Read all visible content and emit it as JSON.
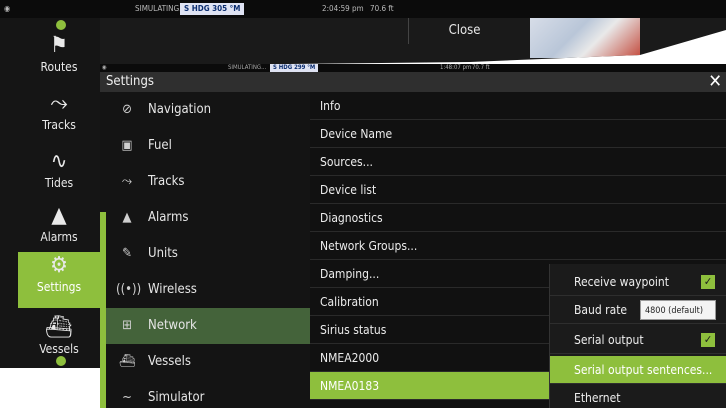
{
  "back": {
    "status": {
      "sim": "SIMULATING...",
      "hdg": "S HDG 305 °M",
      "time": "2:04:59 pm",
      "depth": "70.6 ft"
    },
    "close_label": "Close",
    "sidebar": [
      {
        "label": "Routes",
        "icon": "routes-icon"
      },
      {
        "label": "Tracks",
        "icon": "tracks-icon"
      },
      {
        "label": "Tides",
        "icon": "tides-icon"
      },
      {
        "label": "Alarms",
        "icon": "bell-icon"
      },
      {
        "label": "Settings",
        "icon": "gear-icon"
      },
      {
        "label": "Vessels",
        "icon": "vessel-icon"
      }
    ]
  },
  "front": {
    "status": {
      "sim": "SIMULATING...",
      "hdg": "S HDG 299 °M",
      "time": "1:48:07 pm",
      "depth": "70.7 ft"
    },
    "title": "Settings",
    "close_glyph": "✕",
    "menu": [
      {
        "label": "Navigation",
        "icon": "compass-icon"
      },
      {
        "label": "Fuel",
        "icon": "fuel-icon"
      },
      {
        "label": "Tracks",
        "icon": "tracks-icon"
      },
      {
        "label": "Alarms",
        "icon": "bell-icon"
      },
      {
        "label": "Units",
        "icon": "pencil-icon"
      },
      {
        "label": "Wireless",
        "icon": "wireless-icon"
      },
      {
        "label": "Network",
        "icon": "network-icon"
      },
      {
        "label": "Vessels",
        "icon": "vessel-icon"
      },
      {
        "label": "Simulator",
        "icon": "simulator-icon"
      }
    ],
    "list": [
      "Info",
      "Device Name",
      "Sources...",
      "Device list",
      "Diagnostics",
      "Network Groups...",
      "Damping...",
      "Calibration",
      "Sirius status",
      "NMEA2000",
      "NMEA0183"
    ],
    "subpanel": {
      "receive_waypoint": "Receive waypoint",
      "baud_rate": "Baud rate",
      "baud_value": "4800 (default)",
      "serial_output": "Serial output",
      "serial_output_sentences": "Serial output sentences...",
      "ethernet": "Ethernet"
    }
  },
  "colors": {
    "accent": "#8ebf3d",
    "active_menu": "#44633a"
  }
}
